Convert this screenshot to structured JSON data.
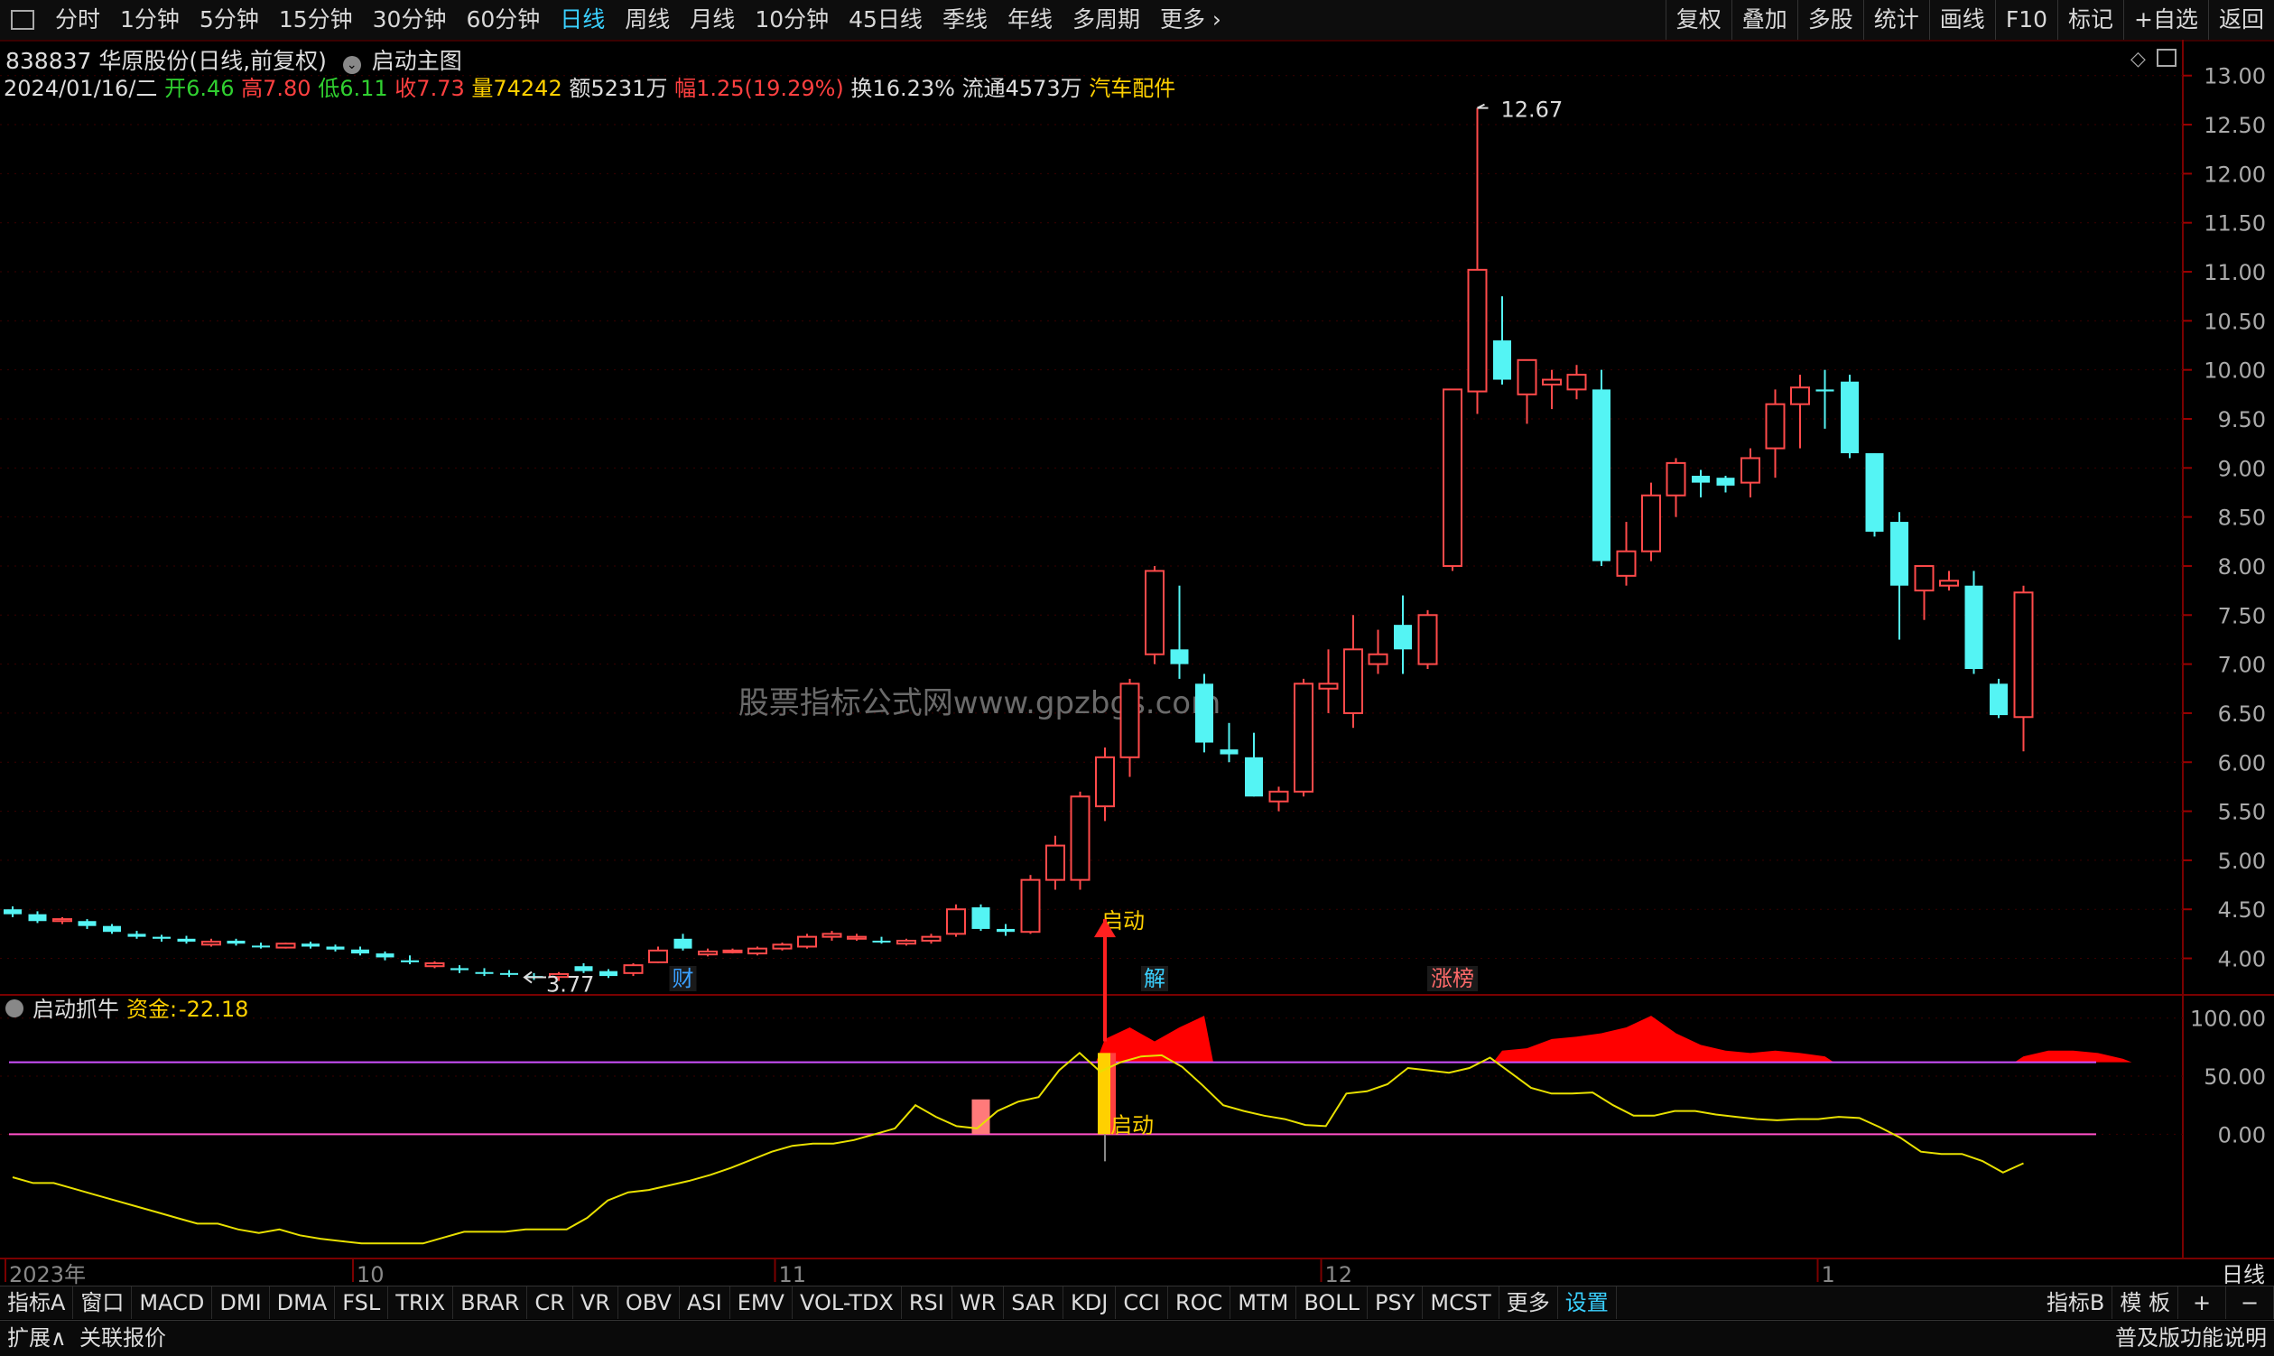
{
  "toolbar": {
    "periods": [
      "分时",
      "1分钟",
      "5分钟",
      "15分钟",
      "30分钟",
      "60分钟",
      "日线",
      "周线",
      "月线",
      "10分钟",
      "45日线",
      "季线",
      "年线",
      "多周期",
      "更多"
    ],
    "active": "日线",
    "right": [
      "复权",
      "叠加",
      "多股",
      "统计",
      "画线",
      "F10",
      "标记",
      "+自选",
      "返回"
    ]
  },
  "stock": {
    "title": "838837 华原股份(日线,前复权)",
    "main_label": "启动主图",
    "date": "2024/01/16/二",
    "open_label": "开",
    "open": "6.46",
    "high_label": "高",
    "high": "7.80",
    "low_label": "低",
    "low": "6.11",
    "close_label": "收",
    "close": "7.73",
    "vol_label": "量",
    "vol": "74242",
    "amount": "额5231万",
    "chg_label": "幅",
    "chg": "1.25(19.29%)",
    "turnover": "换16.23%",
    "float": "流通4573万",
    "sector": "汽车配件"
  },
  "indicator": {
    "name": "启动抓牛",
    "fund_label": "资金:",
    "fund_value": "-22.18"
  },
  "watermark": "股票指标公式网www.gpzbgs.com",
  "chart_data": [
    {
      "type": "candlestick",
      "ylim": [
        3.6,
        13.2
      ],
      "y_ticks": [
        "4.00",
        "4.50",
        "5.00",
        "5.50",
        "6.00",
        "6.50",
        "7.00",
        "7.50",
        "8.00",
        "8.50",
        "9.00",
        "9.50",
        "10.00",
        "10.50",
        "11.00",
        "11.50",
        "12.00",
        "12.50",
        "13.00"
      ],
      "x_ticks": [
        {
          "label": "2023年",
          "i": 0
        },
        {
          "label": "10",
          "i": 14
        },
        {
          "label": "11",
          "i": 31
        },
        {
          "label": "12",
          "i": 53
        },
        {
          "label": "1",
          "i": 73
        }
      ],
      "ohlc": [
        [
          4.5,
          4.53,
          4.42,
          4.45
        ],
        [
          4.45,
          4.48,
          4.36,
          4.38
        ],
        [
          4.38,
          4.42,
          4.35,
          4.4
        ],
        [
          4.38,
          4.4,
          4.3,
          4.33
        ],
        [
          4.33,
          4.35,
          4.25,
          4.27
        ],
        [
          4.25,
          4.28,
          4.2,
          4.22
        ],
        [
          4.22,
          4.24,
          4.17,
          4.2
        ],
        [
          4.2,
          4.23,
          4.15,
          4.17
        ],
        [
          4.14,
          4.2,
          4.12,
          4.17
        ],
        [
          4.18,
          4.2,
          4.13,
          4.15
        ],
        [
          4.13,
          4.16,
          4.1,
          4.12
        ],
        [
          4.11,
          4.16,
          4.1,
          4.15
        ],
        [
          4.15,
          4.17,
          4.1,
          4.12
        ],
        [
          4.12,
          4.14,
          4.07,
          4.09
        ],
        [
          4.09,
          4.12,
          4.03,
          4.05
        ],
        [
          4.05,
          4.07,
          3.98,
          4.01
        ],
        [
          3.98,
          4.03,
          3.94,
          3.96
        ],
        [
          3.92,
          3.97,
          3.9,
          3.95
        ],
        [
          3.9,
          3.93,
          3.85,
          3.88
        ],
        [
          3.86,
          3.9,
          3.82,
          3.85
        ],
        [
          3.85,
          3.88,
          3.81,
          3.84
        ],
        [
          3.82,
          3.85,
          3.78,
          3.81
        ],
        [
          3.81,
          3.86,
          3.77,
          3.84
        ],
        [
          3.92,
          3.95,
          3.85,
          3.87
        ],
        [
          3.87,
          3.89,
          3.8,
          3.82
        ],
        [
          3.85,
          3.95,
          3.82,
          3.93
        ],
        [
          3.96,
          4.12,
          3.95,
          4.08
        ],
        [
          4.2,
          4.25,
          4.08,
          4.1
        ],
        [
          4.04,
          4.1,
          4.02,
          4.07
        ],
        [
          4.07,
          4.1,
          4.05,
          4.08
        ],
        [
          4.05,
          4.12,
          4.03,
          4.1
        ],
        [
          4.1,
          4.16,
          4.08,
          4.14
        ],
        [
          4.12,
          4.25,
          4.1,
          4.22
        ],
        [
          4.22,
          4.28,
          4.18,
          4.25
        ],
        [
          4.2,
          4.25,
          4.18,
          4.22
        ],
        [
          4.18,
          4.22,
          4.15,
          4.17
        ],
        [
          4.15,
          4.2,
          4.13,
          4.18
        ],
        [
          4.18,
          4.25,
          4.15,
          4.22
        ],
        [
          4.25,
          4.55,
          4.22,
          4.5
        ],
        [
          4.52,
          4.55,
          4.28,
          4.3
        ],
        [
          4.3,
          4.35,
          4.23,
          4.27
        ],
        [
          4.27,
          4.85,
          4.25,
          4.8
        ],
        [
          4.8,
          5.25,
          4.7,
          5.15
        ],
        [
          4.8,
          5.7,
          4.7,
          5.65
        ],
        [
          5.55,
          6.15,
          5.4,
          6.05
        ],
        [
          6.05,
          6.85,
          5.85,
          6.8
        ],
        [
          7.1,
          8.0,
          7.0,
          7.95
        ],
        [
          7.15,
          7.8,
          6.85,
          7.0
        ],
        [
          6.8,
          6.9,
          6.1,
          6.2
        ],
        [
          6.13,
          6.4,
          6.0,
          6.08
        ],
        [
          6.05,
          6.3,
          5.65,
          5.65
        ],
        [
          5.6,
          5.75,
          5.5,
          5.7
        ],
        [
          5.7,
          6.85,
          5.65,
          6.8
        ],
        [
          6.75,
          7.15,
          6.5,
          6.8
        ],
        [
          6.5,
          7.5,
          6.35,
          7.15
        ],
        [
          7.0,
          7.35,
          6.9,
          7.1
        ],
        [
          7.4,
          7.7,
          6.9,
          7.15
        ],
        [
          7.0,
          7.55,
          6.95,
          7.5
        ],
        [
          8.0,
          9.8,
          7.95,
          9.8
        ],
        [
          9.78,
          12.67,
          9.55,
          11.02
        ],
        [
          10.3,
          10.75,
          9.85,
          9.9
        ],
        [
          9.75,
          10.1,
          9.45,
          10.1
        ],
        [
          9.85,
          10.0,
          9.6,
          9.9
        ],
        [
          9.8,
          10.05,
          9.7,
          9.95
        ],
        [
          9.8,
          10.0,
          8.0,
          8.05
        ],
        [
          7.9,
          8.45,
          7.8,
          8.15
        ],
        [
          8.15,
          8.85,
          8.05,
          8.72
        ],
        [
          8.72,
          9.1,
          8.5,
          9.05
        ],
        [
          8.92,
          8.98,
          8.7,
          8.85
        ],
        [
          8.9,
          8.92,
          8.75,
          8.82
        ],
        [
          8.85,
          9.2,
          8.7,
          9.1
        ],
        [
          9.2,
          9.8,
          8.9,
          9.65
        ],
        [
          9.65,
          9.95,
          9.2,
          9.82
        ],
        [
          9.8,
          10.0,
          9.4,
          9.78
        ],
        [
          9.88,
          9.95,
          9.1,
          9.15
        ],
        [
          9.15,
          9.15,
          8.3,
          8.35
        ],
        [
          8.45,
          8.55,
          7.25,
          7.8
        ],
        [
          7.75,
          7.95,
          7.45,
          8.0
        ],
        [
          7.8,
          7.95,
          7.75,
          7.85
        ],
        [
          7.8,
          7.95,
          6.9,
          6.95
        ],
        [
          6.8,
          6.85,
          6.45,
          6.48
        ],
        [
          6.46,
          7.8,
          6.11,
          7.73
        ]
      ],
      "annotations": [
        {
          "text": "12.67",
          "i": 59,
          "price": 12.67
        },
        {
          "text": "3.77",
          "i": 22,
          "price": 3.77
        },
        {
          "text": "启动",
          "i": 44,
          "price": 4.55
        }
      ],
      "markers": [
        {
          "text": "财",
          "i": 27,
          "color": "#3aa0ff"
        },
        {
          "text": "解",
          "i": 46,
          "color": "#3ad0ff"
        },
        {
          "text": "涨榜",
          "i": 58,
          "color": "#ff6a6a"
        }
      ]
    },
    {
      "type": "line",
      "name": "启动抓牛",
      "ylim": [
        -100,
        120
      ],
      "y_ticks": [
        "0.00",
        "50.00",
        "100.00"
      ],
      "levels": [
        0,
        62
      ],
      "values": [
        -37,
        -42,
        -42,
        -47,
        -52,
        -57,
        -62,
        -67,
        -72,
        -77,
        -77,
        -82,
        -85,
        -82,
        -87,
        -90,
        -92,
        -94,
        -94,
        -94,
        -94,
        -89,
        -84,
        -84,
        -84,
        -82,
        -82,
        -82,
        -72,
        -57,
        -50,
        -48,
        -44,
        -40,
        -35,
        -29,
        -22,
        -15,
        -10,
        -8,
        -8,
        -5,
        0,
        5,
        25,
        15,
        7,
        5,
        20,
        28,
        32,
        55,
        70,
        54,
        62,
        67,
        68,
        58,
        42,
        25,
        20,
        16,
        13,
        8,
        7,
        35,
        37,
        43,
        57,
        55,
        53,
        57,
        66,
        53,
        40,
        35,
        35,
        36,
        25,
        16,
        16,
        20,
        20,
        17,
        15,
        13,
        12,
        13,
        13,
        15,
        14,
        6,
        -3,
        -15,
        -17,
        -17,
        -23,
        -33,
        -25
      ],
      "fund_fill": [
        [
          34,
          44,
          0
        ],
        [
          35,
          44,
          60
        ],
        [
          36,
          48,
          5
        ]
      ],
      "start_signal": {
        "i": 44,
        "text": "启动"
      }
    }
  ],
  "bottom": {
    "tabs": [
      "指标A",
      "窗口",
      "MACD",
      "DMI",
      "DMA",
      "FSL",
      "TRIX",
      "BRAR",
      "CR",
      "VR",
      "OBV",
      "ASI",
      "EMV",
      "VOL-TDX",
      "RSI",
      "WR",
      "SAR",
      "KDJ",
      "CCI",
      "ROC",
      "MTM",
      "BOLL",
      "PSY",
      "MCST",
      "更多",
      "设置"
    ],
    "active": "设置",
    "right": [
      "指标B",
      "模 板",
      "+",
      "−"
    ],
    "period_label": "日线",
    "expand": "扩展∧",
    "related": "关联报价",
    "version": "普及版功能说明"
  }
}
